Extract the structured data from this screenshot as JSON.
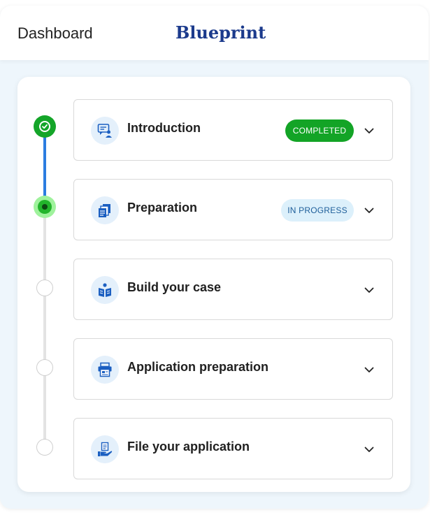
{
  "header": {
    "title": "Dashboard",
    "brand": "Blueprint"
  },
  "steps": [
    {
      "label": "Introduction",
      "status": "COMPLETED",
      "icon": "chat-person-icon"
    },
    {
      "label": "Preparation",
      "status": "IN PROGRESS",
      "icon": "documents-stack-icon"
    },
    {
      "label": "Build your case",
      "status": "",
      "icon": "reading-person-icon"
    },
    {
      "label": "Application preparation",
      "status": "",
      "icon": "printer-form-icon"
    },
    {
      "label": "File your application",
      "status": "",
      "icon": "hand-document-icon"
    }
  ],
  "colors": {
    "brand": "#1b3a8c",
    "completed": "#13a426",
    "in_progress_bg": "#dcf0fb",
    "in_progress_text": "#1e5e9a",
    "progress_line": "#2b7de0",
    "icon_blue": "#1b5fc1"
  }
}
